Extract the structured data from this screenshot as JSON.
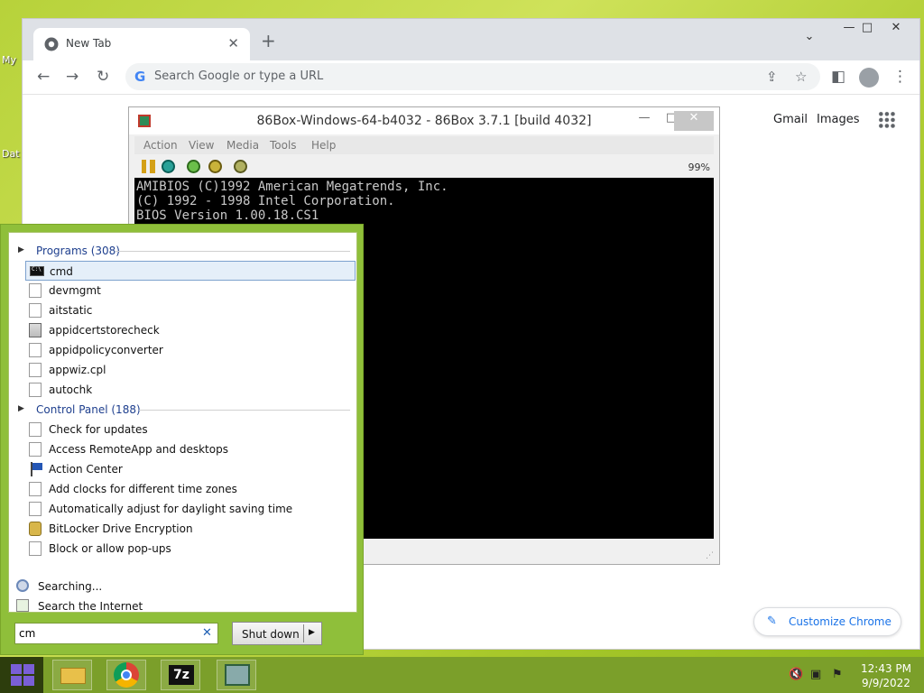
{
  "desktop": {
    "icon_label_1": "My",
    "icon_label_2": "Dat"
  },
  "chrome": {
    "tab_title": "New Tab",
    "new_tab_symbol": "+",
    "omnibox_placeholder": "Search Google or type a URL",
    "links": [
      "Gmail",
      "Images"
    ],
    "customize_label": "Customize Chrome",
    "window_buttons": [
      "⌄",
      "—",
      "□",
      "✕"
    ]
  },
  "box86": {
    "title": "86Box-Windows-64-b4032 - 86Box 3.7.1 [build 4032]",
    "menus": [
      "Action",
      "View",
      "Media",
      "Tools",
      "Help"
    ],
    "speed": "99%",
    "screen_lines": [
      "AMIBIOS (C)1992 American Megatrends, Inc.",
      "(C) 1992 - 1998 Intel Corporation.",
      "BIOS Version 1.00.18.CS1"
    ]
  },
  "startmenu": {
    "programs_header": "Programs (308)",
    "programs": [
      {
        "label": "cmd",
        "icon": "cmd-icon"
      },
      {
        "label": "devmgmt",
        "icon": "file-icon"
      },
      {
        "label": "aitstatic",
        "icon": "file-icon"
      },
      {
        "label": "appidcertstorecheck",
        "icon": "app-icon"
      },
      {
        "label": "appidpolicyconverter",
        "icon": "file-icon"
      },
      {
        "label": "appwiz.cpl",
        "icon": "file-icon"
      },
      {
        "label": "autochk",
        "icon": "file-icon"
      }
    ],
    "control_panel_header": "Control Panel (188)",
    "control_panel": [
      {
        "label": "Check for updates",
        "icon": "file-icon"
      },
      {
        "label": "Access RemoteApp and desktops",
        "icon": "file-icon"
      },
      {
        "label": "Action Center",
        "icon": "flag-icon"
      },
      {
        "label": "Add clocks for different time zones",
        "icon": "file-icon"
      },
      {
        "label": "Automatically adjust for daylight saving time",
        "icon": "file-icon"
      },
      {
        "label": "BitLocker Drive Encryption",
        "icon": "lock-icon"
      },
      {
        "label": "Block or allow pop-ups",
        "icon": "file-icon"
      }
    ],
    "searching": "Searching...",
    "search_internet": "Search the Internet",
    "search_value": "cm",
    "clear_symbol": "✕",
    "shutdown_label": "Shut down",
    "shutdown_arrow": "▶"
  },
  "taskbar": {
    "time": "12:43 PM",
    "date": "9/9/2022",
    "apps": [
      "file-explorer-icon",
      "chrome-icon",
      "7zip-icon",
      "86box-icon"
    ],
    "sevenzip_label": "7z"
  }
}
